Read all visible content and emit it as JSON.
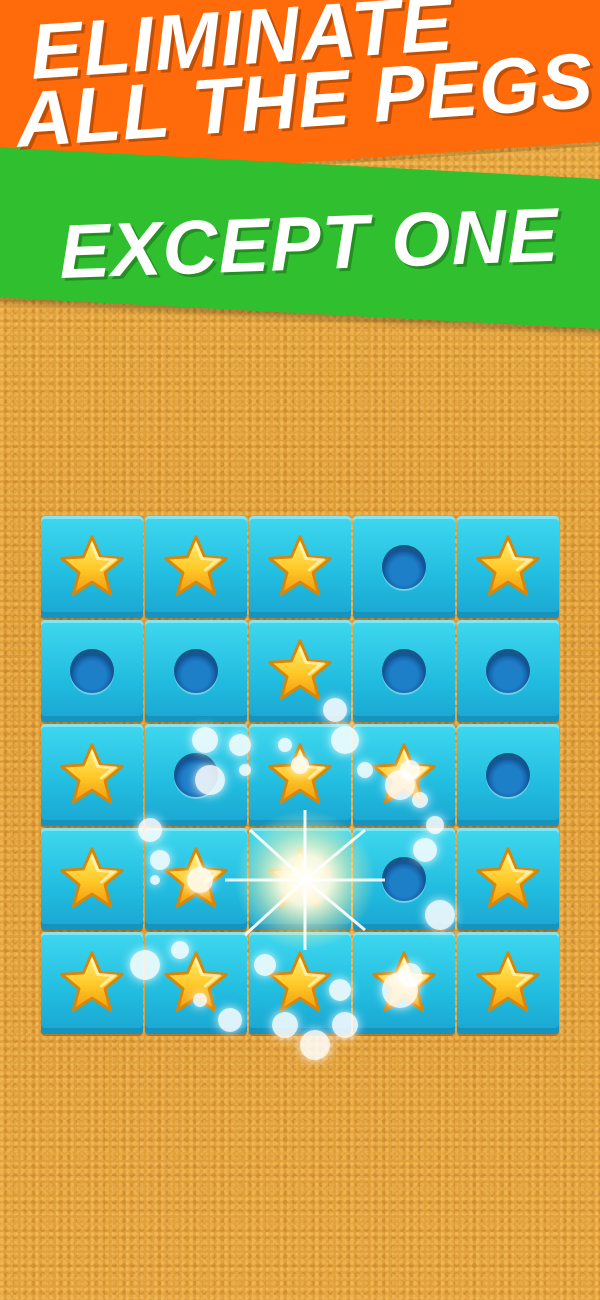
{
  "banner": {
    "line1": "ELIMINATE",
    "line2": "ALL THE PEGS",
    "line3": "EXCEPT ONE"
  },
  "colors": {
    "orange_banner": "#ff6a0a",
    "green_banner": "#2fbf2f",
    "tile": "#22bce0",
    "star": "#ffc928"
  },
  "board": {
    "rows": 5,
    "cols": 5,
    "cells": [
      [
        "peg-star",
        "peg-star",
        "peg-star",
        "hole",
        "peg-star"
      ],
      [
        "hole",
        "hole",
        "peg-star",
        "hole",
        "hole"
      ],
      [
        "peg-star",
        "hole",
        "peg-star",
        "peg-star",
        "hole"
      ],
      [
        "peg-star",
        "peg-star",
        "peg-star",
        "hole",
        "peg-star"
      ],
      [
        "peg-star",
        "peg-star",
        "peg-star",
        "peg-star",
        "peg-star"
      ]
    ]
  },
  "effect": "star-burst-icon"
}
